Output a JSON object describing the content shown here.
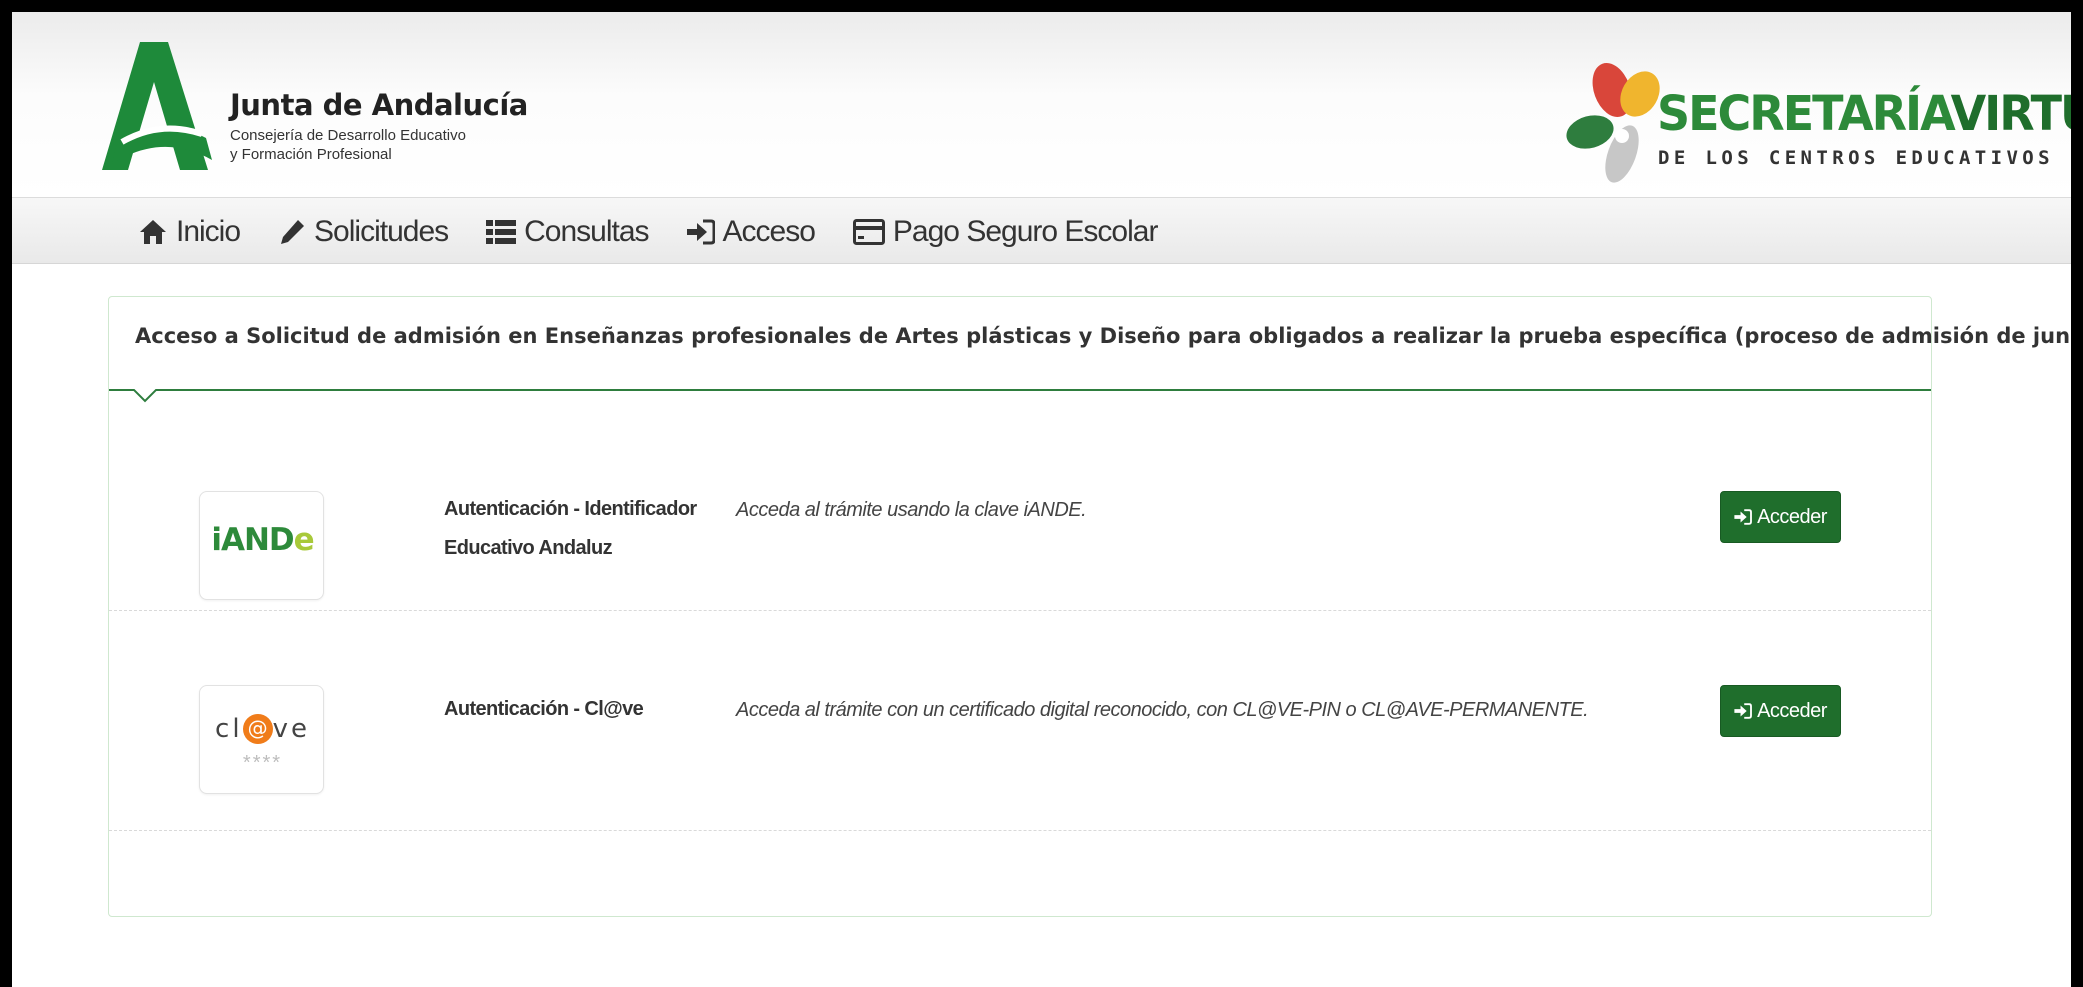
{
  "header": {
    "org_title": "Junta de Andalucía",
    "org_subtitle_line1": "Consejería de Desarrollo Educativo",
    "org_subtitle_line2": "y Formación Profesional",
    "brand_title_part1": "SECRETARÍA",
    "brand_title_part2": "VIRTUAL",
    "brand_subtitle": "DE LOS CENTROS EDUCATIVOS"
  },
  "nav": {
    "items": [
      {
        "label": "Inicio",
        "icon": "home-icon"
      },
      {
        "label": "Solicitudes",
        "icon": "pencil-icon"
      },
      {
        "label": "Consultas",
        "icon": "list-icon"
      },
      {
        "label": "Acceso",
        "icon": "sign-in-icon"
      },
      {
        "label": "Pago Seguro Escolar",
        "icon": "credit-card-icon"
      }
    ]
  },
  "panel": {
    "title": "Acceso a Solicitud de admisión en Enseñanzas profesionales de Artes plásticas y Diseño para obligados a realizar la prueba específica (proceso de admisión de junio)"
  },
  "methods": [
    {
      "logo_text_main": "iAND",
      "logo_text_accent": "e",
      "title_line1": "Autenticación - Identificador",
      "title_line2": "Educativo Andaluz",
      "description": "Acceda al trámite usando la clave iANDE.",
      "button_label": "Acceder"
    },
    {
      "logo_text_pre": "cl",
      "logo_text_at": "@",
      "logo_text_post": "ve",
      "logo_stars": "****",
      "title_line1": "Autenticación - Cl@ve",
      "description": "Acceda al trámite con un certificado digital reconocido, con CL@VE-PIN o CL@AVE-PERMANENTE.",
      "button_label": "Acceder"
    }
  ],
  "colors": {
    "primary_green": "#1f6e2c",
    "brand_green": "#2d8a3a",
    "lime": "#a8c93a",
    "clave_orange": "#f07c1a"
  }
}
